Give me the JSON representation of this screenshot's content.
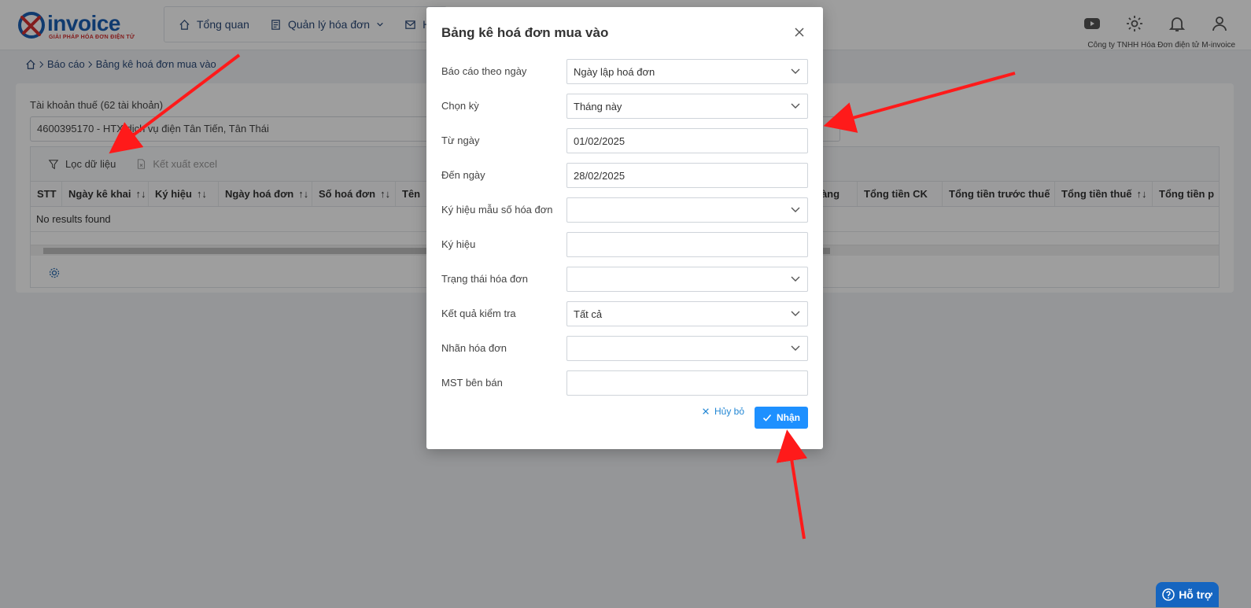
{
  "brand": {
    "name": "invoice",
    "tagline": "GIẢI PHÁP HÓA ĐƠN ĐIỆN TỬ"
  },
  "nav": [
    {
      "label": "Tổng quan",
      "icon": "home-icon"
    },
    {
      "label": "Quản lý hóa đơn",
      "icon": "document-icon"
    },
    {
      "label": "Hộp",
      "icon": "mail-icon"
    }
  ],
  "header": {
    "company": "Công ty TNHH Hóa Đơn điện tử M-invoice"
  },
  "breadcrumb": {
    "level1": "Báo cáo",
    "level2": "Bảng kê hoá đơn mua vào"
  },
  "account": {
    "label": "Tài khoản thuế (62 tài khoản)",
    "value": "4600395170 - HTX dịch vụ điện Tân Tiến, Tân Thái"
  },
  "toolbar": {
    "filter_label": "Lọc dữ liệu",
    "export_label": "Kết xuất excel"
  },
  "table": {
    "columns": [
      "STT",
      "Ngày kê khai",
      "Ký hiệu",
      "Ngày hoá đơn",
      "Số hoá đơn",
      "Tên",
      "hàng",
      "Tổng tiền CK",
      "Tổng tiền trước thuế",
      "Tổng tiền thuế",
      "Tổng tiền p"
    ],
    "empty_text": "No results found"
  },
  "dialog": {
    "title": "Bảng kê hoá đơn mua vào",
    "fields": [
      {
        "label": "Báo cáo theo ngày",
        "value": "Ngày lập hoá đơn",
        "type": "select"
      },
      {
        "label": "Chọn kỳ",
        "value": "Tháng này",
        "type": "select"
      },
      {
        "label": "Từ ngày",
        "value": "01/02/2025",
        "type": "input"
      },
      {
        "label": "Đến ngày",
        "value": "28/02/2025",
        "type": "input"
      },
      {
        "label": "Ký hiệu mẫu số hóa đơn",
        "value": "",
        "type": "select"
      },
      {
        "label": "Ký hiệu",
        "value": "",
        "type": "input"
      },
      {
        "label": "Trạng thái hóa đơn",
        "value": "",
        "type": "select"
      },
      {
        "label": "Kết quả kiểm tra",
        "value": "Tất cả",
        "type": "select"
      },
      {
        "label": "Nhãn hóa đơn",
        "value": "",
        "type": "select"
      },
      {
        "label": "MST bên bán",
        "value": "",
        "type": "input"
      }
    ],
    "cancel_label": "Hủy bỏ",
    "ok_label": "Nhận"
  },
  "support": {
    "label": "Hỗ trợ"
  },
  "colors": {
    "primary": "#1e90ff",
    "nav_text": "#2b4a78",
    "arrow": "#ff1a1a",
    "support": "#1565c0"
  }
}
